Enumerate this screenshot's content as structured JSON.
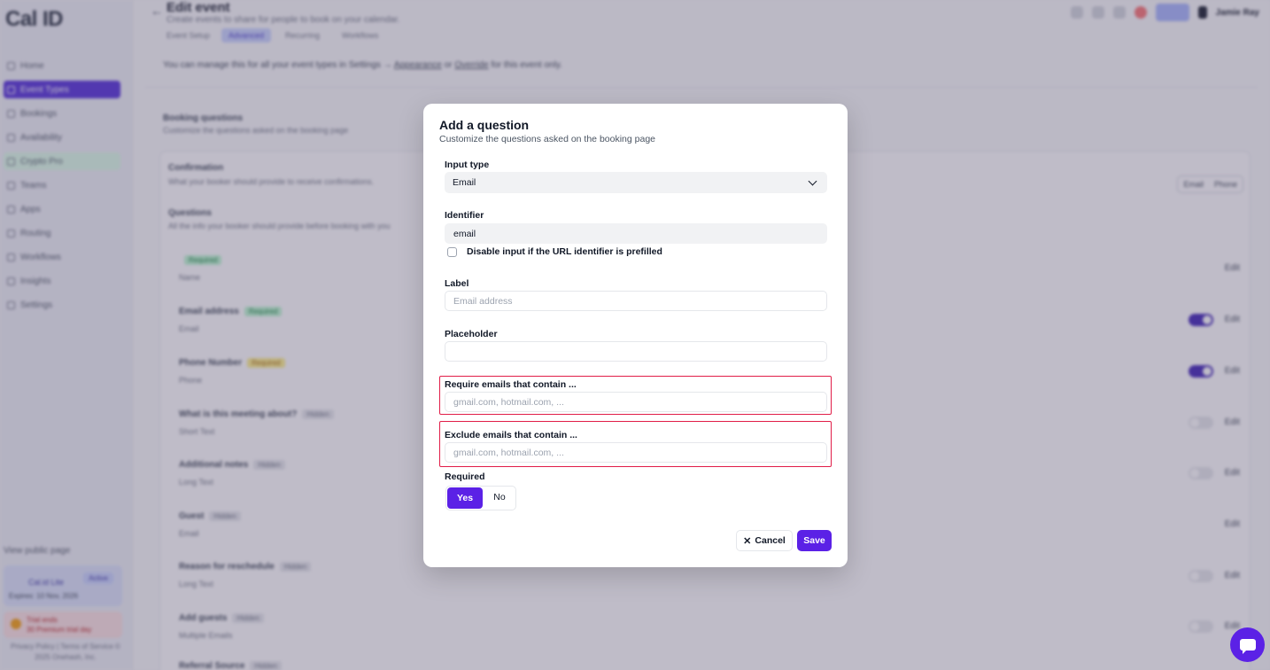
{
  "brand": {
    "name": "Cal ID",
    "accent": "#5b21e6"
  },
  "sidebar": {
    "items": [
      {
        "label": "Home",
        "icon": "home-icon"
      },
      {
        "label": "Event Types",
        "icon": "link-icon",
        "active": true
      },
      {
        "label": "Bookings",
        "icon": "calendar-icon"
      },
      {
        "label": "Availability",
        "icon": "clock-icon"
      },
      {
        "label": "Crypto Pro",
        "icon": "star-icon",
        "highlight": "green"
      },
      {
        "label": "Teams",
        "icon": "users-icon"
      },
      {
        "label": "Apps",
        "icon": "grid-icon"
      },
      {
        "label": "Routing",
        "icon": "routing-icon"
      },
      {
        "label": "Workflows",
        "icon": "zap-icon"
      },
      {
        "label": "Insights",
        "icon": "chart-icon"
      },
      {
        "label": "Settings",
        "icon": "gear-icon"
      }
    ],
    "view_public_page": "View public page",
    "plan_label": "Cal.id Lite",
    "plan_tag": "Active",
    "plan_sub": "Expires: 10 Nov, 2026",
    "trial_line1": "Trial ends",
    "trial_line2": "30 Premium trial day",
    "footer": "Privacy Policy | Terms of Service\n© 2025 Onehash, Inc."
  },
  "header": {
    "back": "←",
    "title": "Edit event",
    "subtitle": "Create events to share for people to book on your calendar.",
    "tabs": [
      "Event Setup",
      "Advanced",
      "Recurring",
      "Workflows"
    ],
    "user": "Jamie Ray",
    "info_line_prefix": "You can manage this for all your event types in Settings →",
    "info_link1": "Appearance",
    "info_mid": "or",
    "info_link2": "Override",
    "info_suffix": "for this event only."
  },
  "booking": {
    "title": "Booking questions",
    "subtitle": "Customize the questions asked on the booking page",
    "confirmation_title": "Confirmation",
    "confirmation_sub": "What your booker should provide to receive confirmations.",
    "questions_title": "Questions",
    "questions_sub": "All the info your booker should provide before booking with you",
    "pill_email": "Email",
    "pill_phone": "Phone",
    "edit_label": "Edit",
    "rows": [
      {
        "label": "",
        "badge": "Required",
        "type": "Name"
      },
      {
        "label": "Email address",
        "badge": "Required",
        "type": "Email"
      },
      {
        "label": "Phone Number",
        "badge": "Required",
        "type": "Phone"
      },
      {
        "label": "What is this meeting about?",
        "badge": "Hidden",
        "type": "Short Text"
      },
      {
        "label": "Additional notes",
        "badge": "Hidden",
        "type": "Long Text"
      },
      {
        "label": "Guest",
        "badge": "Hidden",
        "type": "Email"
      },
      {
        "label": "Reason for reschedule",
        "badge": "Hidden",
        "type": "Long Text"
      },
      {
        "label": "Add guests",
        "badge": "Hidden",
        "type": "Multiple Emails"
      },
      {
        "label": "Referral Source",
        "badge": "Hidden",
        "type": ""
      }
    ]
  },
  "modal": {
    "title": "Add a question",
    "subtitle": "Customize the questions asked on the booking page",
    "input_type_label": "Input type",
    "input_type_value": "Email",
    "identifier_label": "Identifier",
    "identifier_value": "email",
    "disable_checkbox_label": "Disable input if the URL identifier is prefilled",
    "label_label": "Label",
    "label_placeholder": "Email address",
    "placeholder_label": "Placeholder",
    "placeholder_value": "",
    "require_label": "Require emails that contain ...",
    "require_placeholder": "gmail.com, hotmail.com, ...",
    "exclude_label": "Exclude emails that contain ...",
    "exclude_placeholder": "gmail.com, hotmail.com, ...",
    "required_label": "Required",
    "yes": "Yes",
    "no": "No",
    "cancel": "Cancel",
    "save": "Save"
  }
}
